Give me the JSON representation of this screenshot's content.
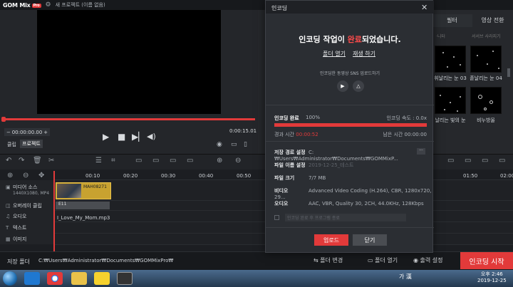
{
  "app": {
    "logo": "GOM Mix",
    "logo_badge": "Pro",
    "project_title": "새 프로젝트 (이름 없음)"
  },
  "preview": {
    "time_current": "00:00:00.00",
    "time_end": "0:00:15.01",
    "clip_label": "클립",
    "project_label": "프로젝트"
  },
  "right_panel": {
    "tabs": [
      {
        "label": "필터"
      },
      {
        "label": "영상 전환"
      }
    ],
    "ghost_texts": [
      "·니터",
      "서서브 사라지기"
    ],
    "thumbs": [
      {
        "label": "휘날리는 눈 03"
      },
      {
        "label": "흩날리는 눈 04"
      },
      {
        "label": "날리는 빛의 눈"
      },
      {
        "label": "비누방울"
      }
    ]
  },
  "timeline": {
    "ruler": [
      "00:10",
      "00:20",
      "00:30",
      "00:40",
      "00:50",
      "01:50",
      "02:00"
    ],
    "tracks": [
      {
        "icon": "▣",
        "label": "미디어 소스",
        "sub": "1440X1080, MP4"
      },
      {
        "icon": "◫",
        "label": "오버레이 클립"
      },
      {
        "icon": "♫",
        "label": "오디오"
      },
      {
        "icon": "T",
        "label": "텍스트"
      },
      {
        "icon": "▦",
        "label": "이미지"
      }
    ],
    "video_clip_name": "MAH08271",
    "overlay_clip_name": "E11",
    "audio_clip_name": "I_Love_My_Mom.mp3"
  },
  "bottom": {
    "save_label": "저장 폴더",
    "save_path": "C:₩Users₩Administrator₩Documents₩GOMMixPro₩",
    "folder_change": "폴더 변경",
    "folder_open": "폴더 열기",
    "output_settings": "출력 설정",
    "encode_start": "인코딩 시작"
  },
  "taskbar": {
    "ime": "가 漢",
    "time": "오후 2:46",
    "date": "2019-12-25"
  },
  "dialog": {
    "title": "인코딩",
    "headline_pre": "인코딩 작업이 ",
    "headline_red": "완료",
    "headline_post": "되었습니다.",
    "link_open_folder": "폴더 열기",
    "link_play": "재생 하기",
    "sns_label": "인코딩한 동영상 SNS 업로드하기",
    "done_label": "인코딩 완료",
    "done_pct": "100%",
    "speed": "인코딩 속도 : 0.0x",
    "progress_fraction": 1.0,
    "elapsed_label": "경과 시간",
    "elapsed_value": "00:00:52",
    "remain": "남은 시간 00:00:00",
    "rows": [
      {
        "k": "저장 경로 설정",
        "v": "C:₩Users₩Administrator₩Documents₩GOMMixP...",
        "dim": false
      },
      {
        "k": "파일 이름 설정",
        "v": "2019-12-25_테스트",
        "dim": true
      },
      {
        "k": "파일 크기",
        "v": "7/7 MB",
        "dim": false
      },
      {
        "k": "비디오",
        "v": "Advanced Video Coding (H.264), CBR, 1280x720, 29...",
        "dim": false
      },
      {
        "k": "오디오",
        "v": "AAC, VBR, Quality 30, 2CH, 44.0KHz, 128Kbps",
        "dim": false
      }
    ],
    "path_button": "···",
    "after_select": "인코딩 완료 후 프로그램 종료",
    "upload_button": "업로드",
    "close_button": "닫기"
  }
}
